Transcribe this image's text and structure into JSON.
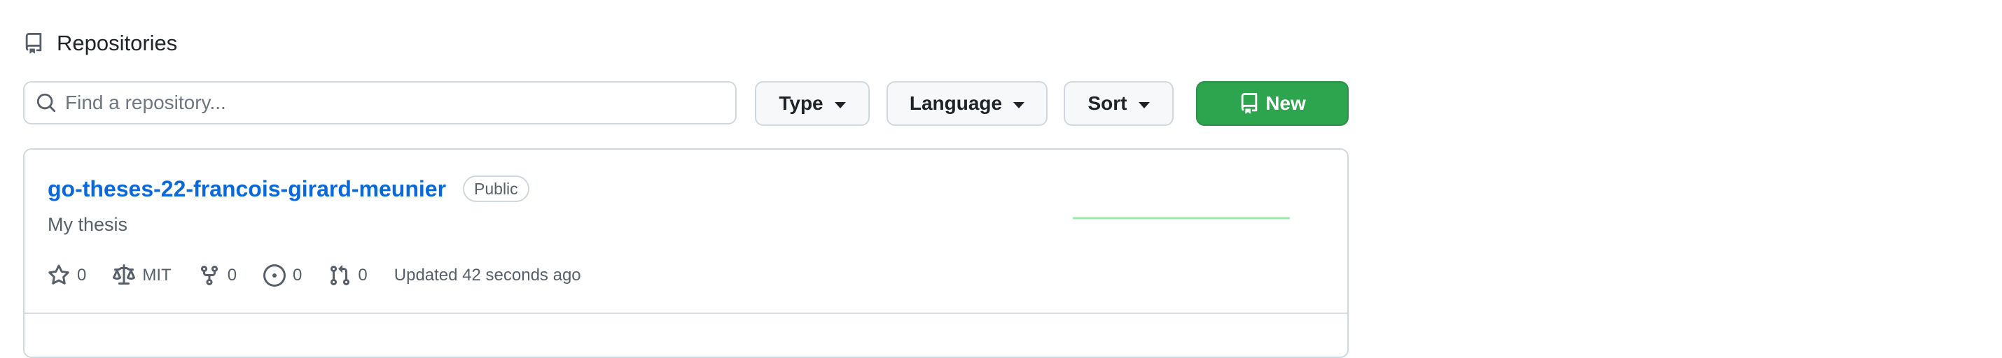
{
  "header": {
    "title": "Repositories",
    "icon": "repo-icon"
  },
  "search": {
    "placeholder": "Find a repository...",
    "value": ""
  },
  "filters": {
    "type_label": "Type",
    "language_label": "Language",
    "sort_label": "Sort"
  },
  "new_button": {
    "label": "New",
    "color": "#2da44e"
  },
  "repos": [
    {
      "name": "go-theses-22-francois-girard-meunier",
      "visibility": "Public",
      "description": "My thesis",
      "stars": "0",
      "license": "MIT",
      "forks": "0",
      "issues": "0",
      "pull_requests": "0",
      "updated": "Updated 42 seconds ago",
      "activity_color": "#9be9a8"
    }
  ],
  "colors": {
    "link": "#0969da",
    "border": "#d0d7de",
    "muted": "#57606a"
  }
}
